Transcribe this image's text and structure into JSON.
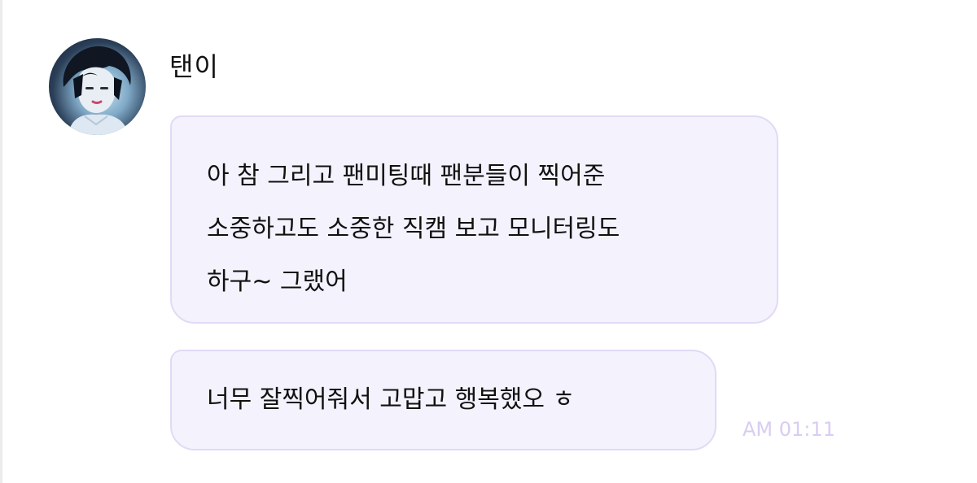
{
  "chat": {
    "sender": {
      "name": "탠이",
      "avatar": "profile-photo"
    },
    "messages": [
      {
        "lines": [
          "아 참 그리고 팬미팅때 팬분들이 찍어준",
          "소중하고도 소중한 직캠 보고 모니터링도",
          "하구~ 그랬어"
        ]
      },
      {
        "lines": [
          "너무 잘찍어줘서 고맙고 행복했오 ㅎ"
        ]
      }
    ],
    "timestamp": "AM 01:11"
  },
  "colors": {
    "bubble_background": "#f4f2fc",
    "bubble_border": "#e2daf6",
    "timestamp": "#d8cdf2",
    "text": "#111111"
  }
}
